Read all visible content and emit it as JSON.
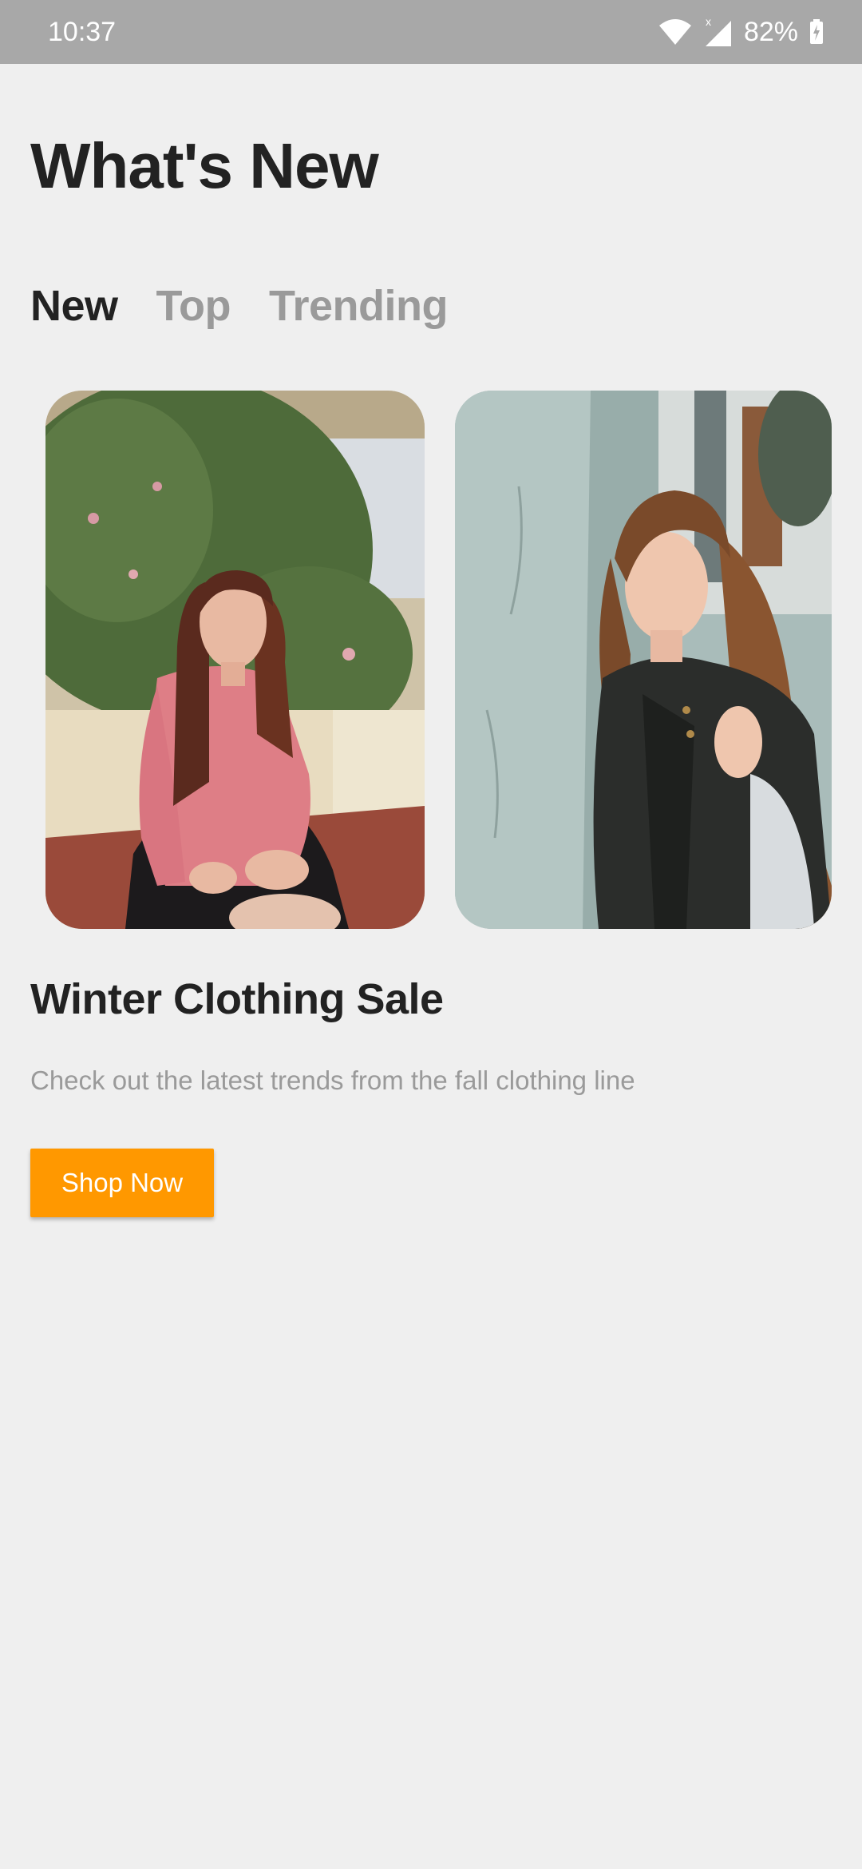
{
  "status_bar": {
    "time": "10:37",
    "battery": "82%",
    "icons": [
      "wifi-icon",
      "signal-icon",
      "battery-charging-icon"
    ]
  },
  "page": {
    "title": "What's New"
  },
  "tabs": [
    {
      "label": "New",
      "active": true
    },
    {
      "label": "Top",
      "active": false
    },
    {
      "label": "Trending",
      "active": false
    }
  ],
  "carousel": {
    "items": [
      {
        "image": "woman-pink-sweater-photo"
      },
      {
        "image": "woman-leather-jacket-photo"
      }
    ]
  },
  "promo": {
    "title": "Winter Clothing Sale",
    "subtitle": "Check out the latest trends from the fall clothing line",
    "button_label": "Shop Now"
  },
  "colors": {
    "background": "#efefef",
    "status_bar": "#a8a8a8",
    "accent": "#ff9800",
    "text_primary": "#222222",
    "text_secondary": "#9a9a9a"
  }
}
